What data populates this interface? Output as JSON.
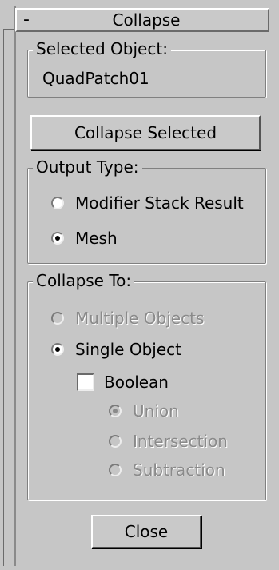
{
  "rollout": {
    "title": "Collapse",
    "collapse_toggle": "-"
  },
  "selected_object": {
    "label": "Selected Object:",
    "value": "QuadPatch01"
  },
  "collapse_selected_button": "Collapse Selected",
  "output_type": {
    "label": "Output Type:",
    "options": [
      {
        "label": "Modifier Stack Result",
        "checked": false,
        "enabled": true
      },
      {
        "label": "Mesh",
        "checked": true,
        "enabled": true
      }
    ]
  },
  "collapse_to": {
    "label": "Collapse To:",
    "options": [
      {
        "label": "Multiple Objects",
        "checked": false,
        "enabled": false
      },
      {
        "label": "Single Object",
        "checked": true,
        "enabled": true
      }
    ],
    "boolean": {
      "label": "Boolean",
      "checked": false,
      "options": [
        {
          "label": "Union",
          "checked": true,
          "enabled": false
        },
        {
          "label": "Intersection",
          "checked": false,
          "enabled": false
        },
        {
          "label": "Subtraction",
          "checked": false,
          "enabled": false
        }
      ]
    }
  },
  "close_button": "Close"
}
